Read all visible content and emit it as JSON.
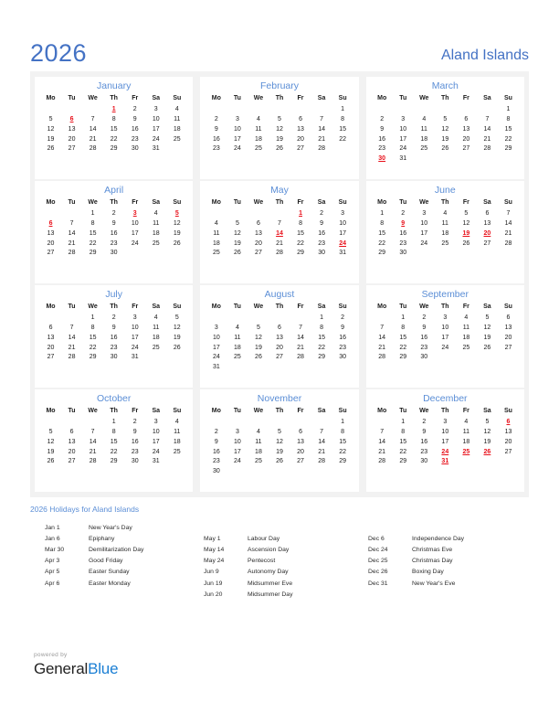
{
  "header": {
    "year": "2026",
    "country": "Aland Islands"
  },
  "weekday_headers": [
    "Mo",
    "Tu",
    "We",
    "Th",
    "Fr",
    "Sa",
    "Su"
  ],
  "colors": {
    "accent_blue": "#4472c4",
    "month_name_blue": "#5b8ed6",
    "holiday_red": "#e8101a",
    "band_gray": "#f2f2f2",
    "logo_blue": "#1b7fd4"
  },
  "months": [
    {
      "name": "January",
      "weeks": [
        [
          "",
          "",
          "",
          "1",
          "2",
          "3",
          "4"
        ],
        [
          "5",
          "6",
          "7",
          "8",
          "9",
          "10",
          "11"
        ],
        [
          "12",
          "13",
          "14",
          "15",
          "16",
          "17",
          "18"
        ],
        [
          "19",
          "20",
          "21",
          "22",
          "23",
          "24",
          "25"
        ],
        [
          "26",
          "27",
          "28",
          "29",
          "30",
          "31",
          ""
        ]
      ],
      "holidays": [
        "1",
        "6"
      ]
    },
    {
      "name": "February",
      "weeks": [
        [
          "",
          "",
          "",
          "",
          "",
          "",
          "1"
        ],
        [
          "2",
          "3",
          "4",
          "5",
          "6",
          "7",
          "8"
        ],
        [
          "9",
          "10",
          "11",
          "12",
          "13",
          "14",
          "15"
        ],
        [
          "16",
          "17",
          "18",
          "19",
          "20",
          "21",
          "22"
        ],
        [
          "23",
          "24",
          "25",
          "26",
          "27",
          "28",
          ""
        ]
      ],
      "holidays": []
    },
    {
      "name": "March",
      "weeks": [
        [
          "",
          "",
          "",
          "",
          "",
          "",
          "1"
        ],
        [
          "2",
          "3",
          "4",
          "5",
          "6",
          "7",
          "8"
        ],
        [
          "9",
          "10",
          "11",
          "12",
          "13",
          "14",
          "15"
        ],
        [
          "16",
          "17",
          "18",
          "19",
          "20",
          "21",
          "22"
        ],
        [
          "23",
          "24",
          "25",
          "26",
          "27",
          "28",
          "29"
        ],
        [
          "30",
          "31",
          "",
          "",
          "",
          "",
          ""
        ]
      ],
      "holidays": [
        "30"
      ]
    },
    {
      "name": "April",
      "weeks": [
        [
          "",
          "",
          "1",
          "2",
          "3",
          "4",
          "5"
        ],
        [
          "6",
          "7",
          "8",
          "9",
          "10",
          "11",
          "12"
        ],
        [
          "13",
          "14",
          "15",
          "16",
          "17",
          "18",
          "19"
        ],
        [
          "20",
          "21",
          "22",
          "23",
          "24",
          "25",
          "26"
        ],
        [
          "27",
          "28",
          "29",
          "30",
          "",
          "",
          ""
        ]
      ],
      "holidays": [
        "3",
        "5",
        "6"
      ]
    },
    {
      "name": "May",
      "weeks": [
        [
          "",
          "",
          "",
          "",
          "1",
          "2",
          "3"
        ],
        [
          "4",
          "5",
          "6",
          "7",
          "8",
          "9",
          "10"
        ],
        [
          "11",
          "12",
          "13",
          "14",
          "15",
          "16",
          "17"
        ],
        [
          "18",
          "19",
          "20",
          "21",
          "22",
          "23",
          "24"
        ],
        [
          "25",
          "26",
          "27",
          "28",
          "29",
          "30",
          "31"
        ]
      ],
      "holidays": [
        "1",
        "14",
        "24"
      ]
    },
    {
      "name": "June",
      "weeks": [
        [
          "1",
          "2",
          "3",
          "4",
          "5",
          "6",
          "7"
        ],
        [
          "8",
          "9",
          "10",
          "11",
          "12",
          "13",
          "14"
        ],
        [
          "15",
          "16",
          "17",
          "18",
          "19",
          "20",
          "21"
        ],
        [
          "22",
          "23",
          "24",
          "25",
          "26",
          "27",
          "28"
        ],
        [
          "29",
          "30",
          "",
          "",
          "",
          "",
          ""
        ]
      ],
      "holidays": [
        "9",
        "19",
        "20"
      ]
    },
    {
      "name": "July",
      "weeks": [
        [
          "",
          "",
          "1",
          "2",
          "3",
          "4",
          "5"
        ],
        [
          "6",
          "7",
          "8",
          "9",
          "10",
          "11",
          "12"
        ],
        [
          "13",
          "14",
          "15",
          "16",
          "17",
          "18",
          "19"
        ],
        [
          "20",
          "21",
          "22",
          "23",
          "24",
          "25",
          "26"
        ],
        [
          "27",
          "28",
          "29",
          "30",
          "31",
          "",
          ""
        ]
      ],
      "holidays": []
    },
    {
      "name": "August",
      "weeks": [
        [
          "",
          "",
          "",
          "",
          "",
          "1",
          "2"
        ],
        [
          "3",
          "4",
          "5",
          "6",
          "7",
          "8",
          "9"
        ],
        [
          "10",
          "11",
          "12",
          "13",
          "14",
          "15",
          "16"
        ],
        [
          "17",
          "18",
          "19",
          "20",
          "21",
          "22",
          "23"
        ],
        [
          "24",
          "25",
          "26",
          "27",
          "28",
          "29",
          "30"
        ],
        [
          "31",
          "",
          "",
          "",
          "",
          "",
          ""
        ]
      ],
      "holidays": []
    },
    {
      "name": "September",
      "weeks": [
        [
          "",
          "1",
          "2",
          "3",
          "4",
          "5",
          "6"
        ],
        [
          "7",
          "8",
          "9",
          "10",
          "11",
          "12",
          "13"
        ],
        [
          "14",
          "15",
          "16",
          "17",
          "18",
          "19",
          "20"
        ],
        [
          "21",
          "22",
          "23",
          "24",
          "25",
          "26",
          "27"
        ],
        [
          "28",
          "29",
          "30",
          "",
          "",
          "",
          ""
        ]
      ],
      "holidays": []
    },
    {
      "name": "October",
      "weeks": [
        [
          "",
          "",
          "",
          "1",
          "2",
          "3",
          "4"
        ],
        [
          "5",
          "6",
          "7",
          "8",
          "9",
          "10",
          "11"
        ],
        [
          "12",
          "13",
          "14",
          "15",
          "16",
          "17",
          "18"
        ],
        [
          "19",
          "20",
          "21",
          "22",
          "23",
          "24",
          "25"
        ],
        [
          "26",
          "27",
          "28",
          "29",
          "30",
          "31",
          ""
        ]
      ],
      "holidays": []
    },
    {
      "name": "November",
      "weeks": [
        [
          "",
          "",
          "",
          "",
          "",
          "",
          "1"
        ],
        [
          "2",
          "3",
          "4",
          "5",
          "6",
          "7",
          "8"
        ],
        [
          "9",
          "10",
          "11",
          "12",
          "13",
          "14",
          "15"
        ],
        [
          "16",
          "17",
          "18",
          "19",
          "20",
          "21",
          "22"
        ],
        [
          "23",
          "24",
          "25",
          "26",
          "27",
          "28",
          "29"
        ],
        [
          "30",
          "",
          "",
          "",
          "",
          "",
          ""
        ]
      ],
      "holidays": []
    },
    {
      "name": "December",
      "weeks": [
        [
          "",
          "1",
          "2",
          "3",
          "4",
          "5",
          "6"
        ],
        [
          "7",
          "8",
          "9",
          "10",
          "11",
          "12",
          "13"
        ],
        [
          "14",
          "15",
          "16",
          "17",
          "18",
          "19",
          "20"
        ],
        [
          "21",
          "22",
          "23",
          "24",
          "25",
          "26",
          "27"
        ],
        [
          "28",
          "29",
          "30",
          "31",
          "",
          "",
          ""
        ]
      ],
      "holidays": [
        "6",
        "24",
        "25",
        "26",
        "31"
      ]
    }
  ],
  "holidays_section": {
    "heading": "2026 Holidays for Aland Islands",
    "columns": [
      {
        "offset": 0,
        "entries": [
          {
            "date": "Jan 1",
            "name": "New Year's Day"
          },
          {
            "date": "Jan 6",
            "name": "Epiphany"
          },
          {
            "date": "Mar 30",
            "name": "Demilitarization Day"
          },
          {
            "date": "Apr 3",
            "name": "Good Friday"
          },
          {
            "date": "Apr 5",
            "name": "Easter Sunday"
          },
          {
            "date": "Apr 6",
            "name": "Easter Monday"
          }
        ]
      },
      {
        "offset": 1,
        "entries": [
          {
            "date": "May 1",
            "name": "Labour Day"
          },
          {
            "date": "May 14",
            "name": "Ascension Day"
          },
          {
            "date": "May 24",
            "name": "Pentecost"
          },
          {
            "date": "Jun 9",
            "name": "Autonomy Day"
          },
          {
            "date": "Jun 19",
            "name": "Midsummer Eve"
          },
          {
            "date": "Jun 20",
            "name": "Midsummer Day"
          }
        ]
      },
      {
        "offset": 1,
        "entries": [
          {
            "date": "Dec 6",
            "name": "Independence Day"
          },
          {
            "date": "Dec 24",
            "name": "Christmas Eve"
          },
          {
            "date": "Dec 25",
            "name": "Christmas Day"
          },
          {
            "date": "Dec 26",
            "name": "Boxing Day"
          },
          {
            "date": "Dec 31",
            "name": "New Year's Eve"
          }
        ]
      }
    ]
  },
  "footer": {
    "powered_by": "powered by",
    "logo_part1": "General",
    "logo_part2": "Blue"
  }
}
